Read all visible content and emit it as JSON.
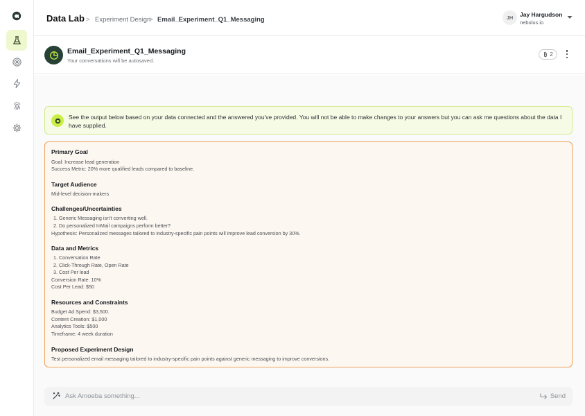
{
  "header": {
    "app_title": "Data Lab",
    "breadcrumb": [
      {
        "label": "Experiment Design"
      },
      {
        "label": "Email_Experiment_Q1_Messaging"
      }
    ],
    "breadcrumb_sep": ">",
    "user": {
      "initials": "JH",
      "name": "Jay Hargudson",
      "org": "nebulus.io"
    }
  },
  "sidebar": {
    "items": [
      {
        "icon": "flask-icon",
        "active": true
      },
      {
        "icon": "target-icon",
        "active": false
      },
      {
        "icon": "lightning-icon",
        "active": false
      },
      {
        "icon": "fingerprint-icon",
        "active": false
      },
      {
        "icon": "gear-icon",
        "active": false
      }
    ]
  },
  "conversation": {
    "title": "Email_Experiment_Q1_Messaging",
    "subtitle": "Your conversations will be autosaved.",
    "attachment_count": "2"
  },
  "banner": {
    "text": "See the output below based on your data connected and the answered you've provided. You will not be able to make changes to your answers but you can ask me questions about the data I have supplied."
  },
  "summary": {
    "sections": [
      {
        "title": "Primary Goal",
        "lines": [
          "Goal: Increase lead generation",
          "Success Metric: 20% more qualified leads compared to baseline."
        ]
      },
      {
        "title": "Target Audience",
        "lines": [
          "Mid-level decision-makers"
        ]
      },
      {
        "title": "Challenges/Uncertainties",
        "lines": [
          "1.  Generic Messaging isn't converting well.",
          "2.  Do personalized InMail campaigns perform better?",
          "Hypothesis: Personalized messages tailored to industry-specific pain points will improve lead conversion by 30%."
        ]
      },
      {
        "title": "Data and Metrics",
        "lines": [
          "1.  Conversation Rate",
          "2.  Click-Through Rate, Open Rate",
          "3.  Cost Per lead",
          "Conversion Rate: 10%",
          "Cost Per Lead: $50"
        ]
      },
      {
        "title": "Resources and Constraints",
        "lines": [
          "Budget Ad Spend: $3,500.",
          "Content Creation: $1,000",
          "Analytics Tools: $500",
          "Timeframe: 4 week duration"
        ]
      },
      {
        "title": "Proposed Experiment Design",
        "lines": [
          "Test personalized email messaging tailored to industry-specific pain points against generic messaging to improve conversions."
        ]
      }
    ]
  },
  "composer": {
    "placeholder": "Ask Amoeba something...",
    "value": "",
    "send_label": "Send"
  },
  "colors": {
    "accent_lime": "#c9ef45",
    "sidebar_active": "#eef8cf",
    "summary_border": "#f0a25a",
    "conv_avatar": "#274235"
  }
}
